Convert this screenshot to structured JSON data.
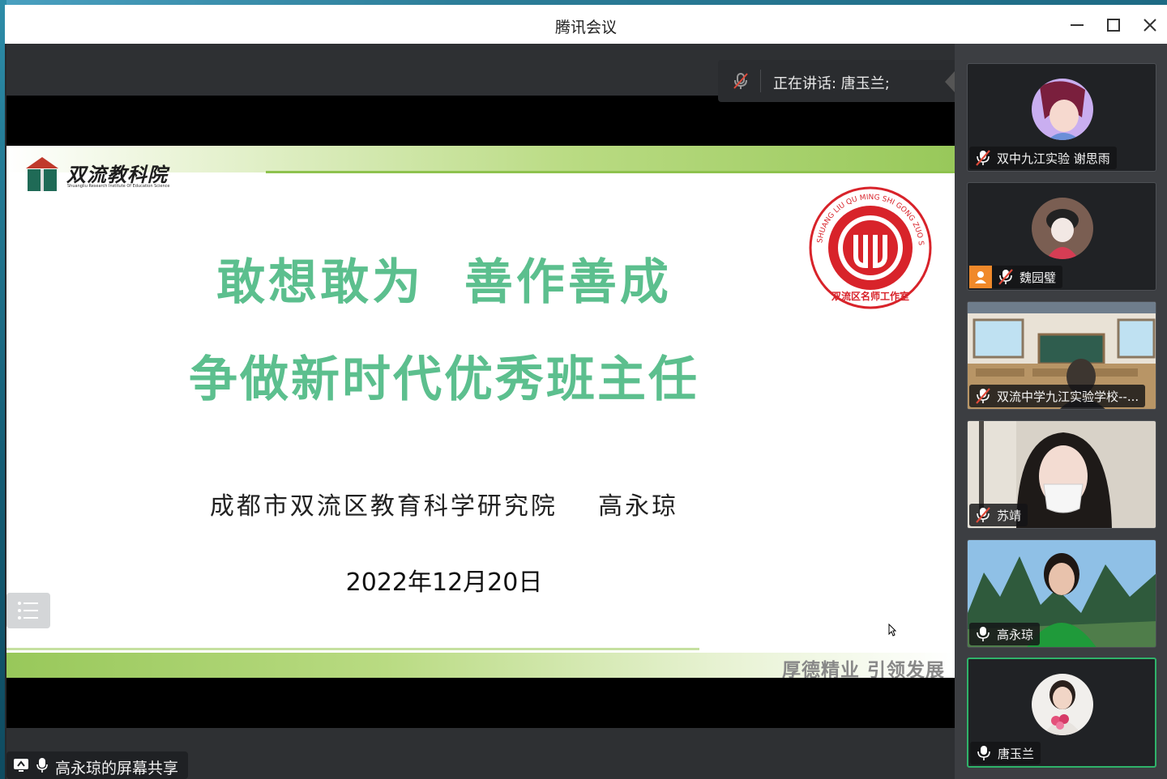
{
  "window": {
    "title": "腾讯会议"
  },
  "speaking": {
    "text": "正在讲话: 唐玉兰;"
  },
  "slide": {
    "logo_title": "双流教科院",
    "logo_subtitle": "Shuangliu Research Institute Of Education Science",
    "seal_ring_text": "SHUANG LIU QU MING SHI GONG ZUO SHI",
    "seal_bottom_text": "双流区名师工作室",
    "headline_line1": "敢想敢为  善作善成",
    "headline_line2": "争做新时代优秀班主任",
    "author": "成都市双流区教育科学研究院    高永琼",
    "date": "2022年12月20日",
    "motto": "厚德精业 引领发展"
  },
  "share_bar": {
    "label": "高永琼的屏幕共享"
  },
  "participants": [
    {
      "name": "双中九江实验 谢思雨",
      "mic": "muted",
      "video": "avatar"
    },
    {
      "name": "魏园璧",
      "mic": "muted",
      "video": "avatar",
      "host": true
    },
    {
      "name": "双流中学九江实验学校--...",
      "mic": "muted",
      "video": "camera"
    },
    {
      "name": "苏靖",
      "mic": "muted",
      "video": "camera"
    },
    {
      "name": "高永琼",
      "mic": "on",
      "video": "camera"
    },
    {
      "name": "唐玉兰",
      "mic": "on",
      "video": "avatar",
      "active": true
    }
  ],
  "colors": {
    "headline": "#5cbf8e",
    "band": "#98c85a",
    "seal": "#d8232a",
    "active_border": "#2fb36a",
    "host_badge": "#f0892a"
  }
}
